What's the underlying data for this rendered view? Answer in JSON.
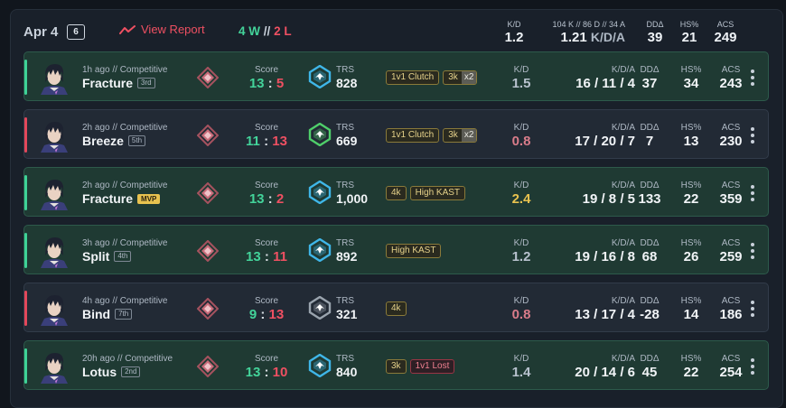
{
  "header": {
    "date": "Apr 4",
    "count": "6",
    "report_label": "View Report",
    "wins": "4 W",
    "sep": "//",
    "losses": "2 L",
    "kd_label": "K/D",
    "kd_value": "1.2",
    "kda_label": "104 K // 86 D // 34 A",
    "kda_value": "1.21",
    "kda_suffix": "K/D/A",
    "ddd_label": "DDΔ",
    "ddd_value": "39",
    "hs_label": "HS%",
    "hs_value": "21",
    "acs_label": "ACS",
    "acs_value": "249"
  },
  "labels": {
    "score": "Score",
    "trs": "TRS",
    "kd": "K/D",
    "kda": "K/D/A",
    "ddd": "DDΔ",
    "hs": "HS%",
    "acs": "ACS"
  },
  "matches": [
    {
      "result": "win",
      "meta": "1h ago // Competitive",
      "map": "Fracture",
      "place": "3rd",
      "mvp": false,
      "score_a": "13",
      "score_b": "5",
      "score_a_color": "win",
      "score_b_color": "loss",
      "trs": "828",
      "trs_color": "#3fb6e8",
      "tags": [
        {
          "text": "1v1 Clutch",
          "red": false
        },
        {
          "text": "3k",
          "mult": "x2",
          "red": false
        }
      ],
      "kd": "1.5",
      "kd_class": "neutral",
      "kda": "16 / 11 / 4",
      "ddd": "37",
      "hs": "34",
      "acs": "243"
    },
    {
      "result": "loss",
      "meta": "2h ago // Competitive",
      "map": "Breeze",
      "place": "5th",
      "mvp": false,
      "score_a": "11",
      "score_b": "13",
      "score_a_color": "win",
      "score_b_color": "loss",
      "trs": "669",
      "trs_color": "#4fcf6a",
      "tags": [
        {
          "text": "1v1 Clutch",
          "red": false
        },
        {
          "text": "3k",
          "mult": "x2",
          "red": false
        }
      ],
      "kd": "0.8",
      "kd_class": "bad",
      "kda": "17 / 20 / 7",
      "ddd": "7",
      "hs": "13",
      "acs": "230"
    },
    {
      "result": "win",
      "meta": "2h ago // Competitive",
      "map": "Fracture",
      "place": "MVP",
      "mvp": true,
      "score_a": "13",
      "score_b": "2",
      "score_a_color": "win",
      "score_b_color": "loss",
      "trs": "1,000",
      "trs_color": "#3fb6e8",
      "tags": [
        {
          "text": "4k",
          "red": false
        },
        {
          "text": "High KAST",
          "red": false
        }
      ],
      "kd": "2.4",
      "kd_class": "good",
      "kda": "19 / 8 / 5",
      "ddd": "133",
      "hs": "22",
      "acs": "359"
    },
    {
      "result": "win",
      "meta": "3h ago // Competitive",
      "map": "Split",
      "place": "4th",
      "mvp": false,
      "score_a": "13",
      "score_b": "11",
      "score_a_color": "win",
      "score_b_color": "loss",
      "trs": "892",
      "trs_color": "#3fb6e8",
      "tags": [
        {
          "text": "High KAST",
          "red": false
        }
      ],
      "kd": "1.2",
      "kd_class": "neutral",
      "kda": "19 / 16 / 8",
      "ddd": "68",
      "hs": "26",
      "acs": "259"
    },
    {
      "result": "loss",
      "meta": "4h ago // Competitive",
      "map": "Bind",
      "place": "7th",
      "mvp": false,
      "score_a": "9",
      "score_b": "13",
      "score_a_color": "win",
      "score_b_color": "loss",
      "trs": "321",
      "trs_color": "#9aa4ae",
      "tags": [
        {
          "text": "4k",
          "red": false
        }
      ],
      "kd": "0.8",
      "kd_class": "bad",
      "kda": "13 / 17 / 4",
      "ddd": "-28",
      "hs": "14",
      "acs": "186"
    },
    {
      "result": "win",
      "meta": "20h ago // Competitive",
      "map": "Lotus",
      "place": "2nd",
      "mvp": false,
      "score_a": "13",
      "score_b": "10",
      "score_a_color": "win",
      "score_b_color": "loss",
      "trs": "840",
      "trs_color": "#3fb6e8",
      "tags": [
        {
          "text": "3k",
          "red": false
        },
        {
          "text": "1v1 Lost",
          "red": true
        }
      ],
      "kd": "1.4",
      "kd_class": "neutral",
      "kda": "20 / 14 / 6",
      "ddd": "45",
      "hs": "22",
      "acs": "254"
    }
  ]
}
